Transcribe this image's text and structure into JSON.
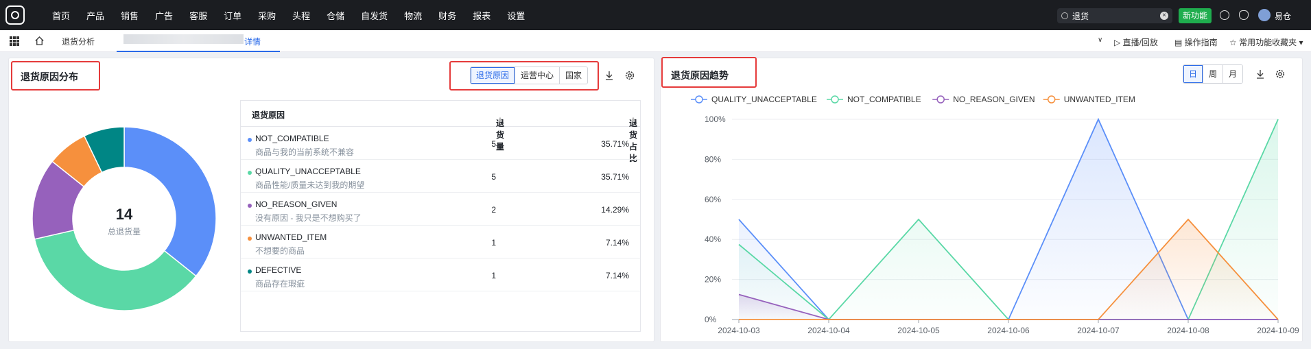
{
  "nav": {
    "menu": [
      "首页",
      "产品",
      "销售",
      "广告",
      "客服",
      "订单",
      "采购",
      "头程",
      "仓储",
      "自发货",
      "物流",
      "财务",
      "报表",
      "设置"
    ],
    "search_value": "退货",
    "new_feature": "新功能",
    "user": "易仓"
  },
  "tabs": {
    "tab1": "退货分析",
    "tab2_suffix": "详情",
    "right": [
      "直播/回放",
      "操作指南",
      "常用功能收藏夹"
    ]
  },
  "left_panel": {
    "title": "退货原因分布",
    "segments": [
      "退货原因",
      "运营中心",
      "国家"
    ],
    "active_segment": 0,
    "donut_total": "14",
    "donut_label": "总退货量",
    "table": {
      "headers": [
        "退货原因",
        "退货量",
        "退货占比"
      ],
      "rows": [
        {
          "code": "NOT_COMPATIBLE",
          "desc": "商品与我的当前系统不兼容",
          "qty": "5",
          "pct": "35.71%",
          "color": "#5b8ff9"
        },
        {
          "code": "QUALITY_UNACCEPTABLE",
          "desc": "商品性能/质量未达到我的期望",
          "qty": "5",
          "pct": "35.71%",
          "color": "#5ad8a6"
        },
        {
          "code": "NO_REASON_GIVEN",
          "desc": "没有原因 - 我只是不想购买了",
          "qty": "2",
          "pct": "14.29%",
          "color": "#9661bc"
        },
        {
          "code": "UNWANTED_ITEM",
          "desc": "不想要的商品",
          "qty": "1",
          "pct": "7.14%",
          "color": "#f6903d"
        },
        {
          "code": "DEFECTIVE",
          "desc": "商品存在瑕疵",
          "qty": "1",
          "pct": "7.14%",
          "color": "#008685"
        }
      ]
    }
  },
  "right_panel": {
    "title": "退货原因趋势",
    "segments": [
      "日",
      "周",
      "月"
    ],
    "active_segment": 0
  },
  "chart_data": [
    {
      "type": "pie",
      "categories": [
        "NOT_COMPATIBLE",
        "QUALITY_UNACCEPTABLE",
        "NO_REASON_GIVEN",
        "UNWANTED_ITEM",
        "DEFECTIVE"
      ],
      "values": [
        5,
        5,
        2,
        1,
        1
      ],
      "colors": [
        "#5b8ff9",
        "#5ad8a6",
        "#9661bc",
        "#f6903d",
        "#008685"
      ],
      "center_value": "14",
      "center_label": "总退货量"
    },
    {
      "type": "line",
      "x": [
        "2024-10-03",
        "2024-10-04",
        "2024-10-05",
        "2024-10-06",
        "2024-10-07",
        "2024-10-08",
        "2024-10-09"
      ],
      "yticks": [
        "0%",
        "20%",
        "40%",
        "60%",
        "80%",
        "100%"
      ],
      "ylim": [
        0,
        100
      ],
      "series": [
        {
          "name": "QUALITY_UNACCEPTABLE",
          "color": "#5b8ff9",
          "values": [
            50,
            0,
            0,
            0,
            100,
            0,
            0
          ]
        },
        {
          "name": "NOT_COMPATIBLE",
          "color": "#5ad8a6",
          "values": [
            37.5,
            0,
            50,
            0,
            0,
            0,
            100
          ]
        },
        {
          "name": "NO_REASON_GIVEN",
          "color": "#9661bc",
          "values": [
            12.5,
            0,
            0,
            0,
            0,
            0,
            0
          ]
        },
        {
          "name": "UNWANTED_ITEM",
          "color": "#f6903d",
          "values": [
            0,
            0,
            0,
            0,
            0,
            50,
            0
          ]
        }
      ],
      "legend": "top-left"
    }
  ]
}
